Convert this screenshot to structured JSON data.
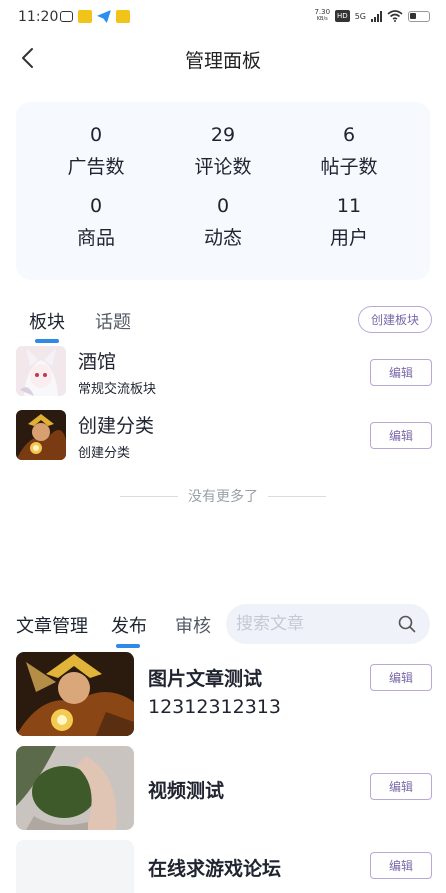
{
  "status_bar": {
    "time": "11:20",
    "net_speed_value": "7.30",
    "net_speed_unit": "KB/s",
    "hd": "HD",
    "network": "5G"
  },
  "header": {
    "title": "管理面板"
  },
  "stats": [
    {
      "value": "0",
      "label": "广告数"
    },
    {
      "value": "29",
      "label": "评论数"
    },
    {
      "value": "6",
      "label": "帖子数"
    },
    {
      "value": "0",
      "label": "商品"
    },
    {
      "value": "0",
      "label": "动态"
    },
    {
      "value": "11",
      "label": "用户"
    }
  ],
  "section_tabs": {
    "tabs": [
      "板块",
      "话题"
    ],
    "active_index": 0,
    "create_button": "创建板块"
  },
  "boards": [
    {
      "name": "酒馆",
      "description": "常规交流板块",
      "edit_label": "编辑"
    },
    {
      "name": "创建分类",
      "description": "创建分类",
      "edit_label": "编辑"
    }
  ],
  "no_more_text": "没有更多了",
  "articles_section": {
    "label": "文章管理",
    "tabs": [
      "发布",
      "审核"
    ],
    "active_index": 0,
    "search_placeholder": "搜索文章"
  },
  "articles": [
    {
      "title": "图片文章测试",
      "subtitle": "12312312313",
      "edit_label": "编辑"
    },
    {
      "title": "视频测试",
      "subtitle": "",
      "edit_label": "编辑"
    },
    {
      "title": "在线求游戏论坛",
      "subtitle": "",
      "edit_label": "编辑"
    }
  ],
  "colors": {
    "accent": "#2e8ae6",
    "button_border": "#b9a8d6",
    "button_text": "#7b68a8",
    "card_bg": "#f6f9fd"
  }
}
